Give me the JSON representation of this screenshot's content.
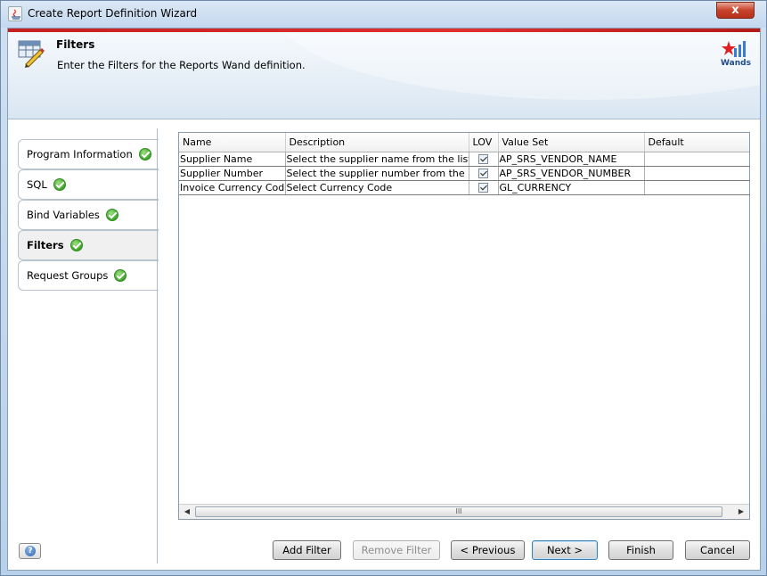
{
  "window": {
    "title": "Create Report Definition Wizard",
    "close_label": "x"
  },
  "header": {
    "title": "Filters",
    "subtitle": "Enter the Filters for the Reports Wand definition.",
    "logo_label": "Wands"
  },
  "steps": [
    {
      "label": "Program Information",
      "completed": true,
      "active": false
    },
    {
      "label": "SQL",
      "completed": true,
      "active": false
    },
    {
      "label": "Bind Variables",
      "completed": true,
      "active": false
    },
    {
      "label": "Filters",
      "completed": true,
      "active": true
    },
    {
      "label": "Request Groups",
      "completed": true,
      "active": false
    }
  ],
  "table": {
    "columns": [
      "Name",
      "Description",
      "LOV",
      "Value Set",
      "Default"
    ],
    "rows": [
      {
        "name": "Supplier Name",
        "description": "Select the supplier name from the list",
        "lov": true,
        "value_set": "AP_SRS_VENDOR_NAME",
        "default": ""
      },
      {
        "name": "Supplier Number",
        "description": "Select the supplier number from the list",
        "lov": true,
        "value_set": "AP_SRS_VENDOR_NUMBER",
        "default": ""
      },
      {
        "name": "Invoice Currency Code",
        "description": "Select Currency Code",
        "lov": true,
        "value_set": "GL_CURRENCY",
        "default": ""
      }
    ],
    "scroll_thumb_label": "III"
  },
  "buttons": {
    "add_filter": "Add Filter",
    "remove_filter": "Remove Filter",
    "previous": "< Previous",
    "next": "Next >",
    "finish": "Finish",
    "cancel": "Cancel"
  },
  "colors": {
    "accent_red": "#c61f1f",
    "check_green": "#3ea52a",
    "default_button_border": "#3c7fb1"
  }
}
